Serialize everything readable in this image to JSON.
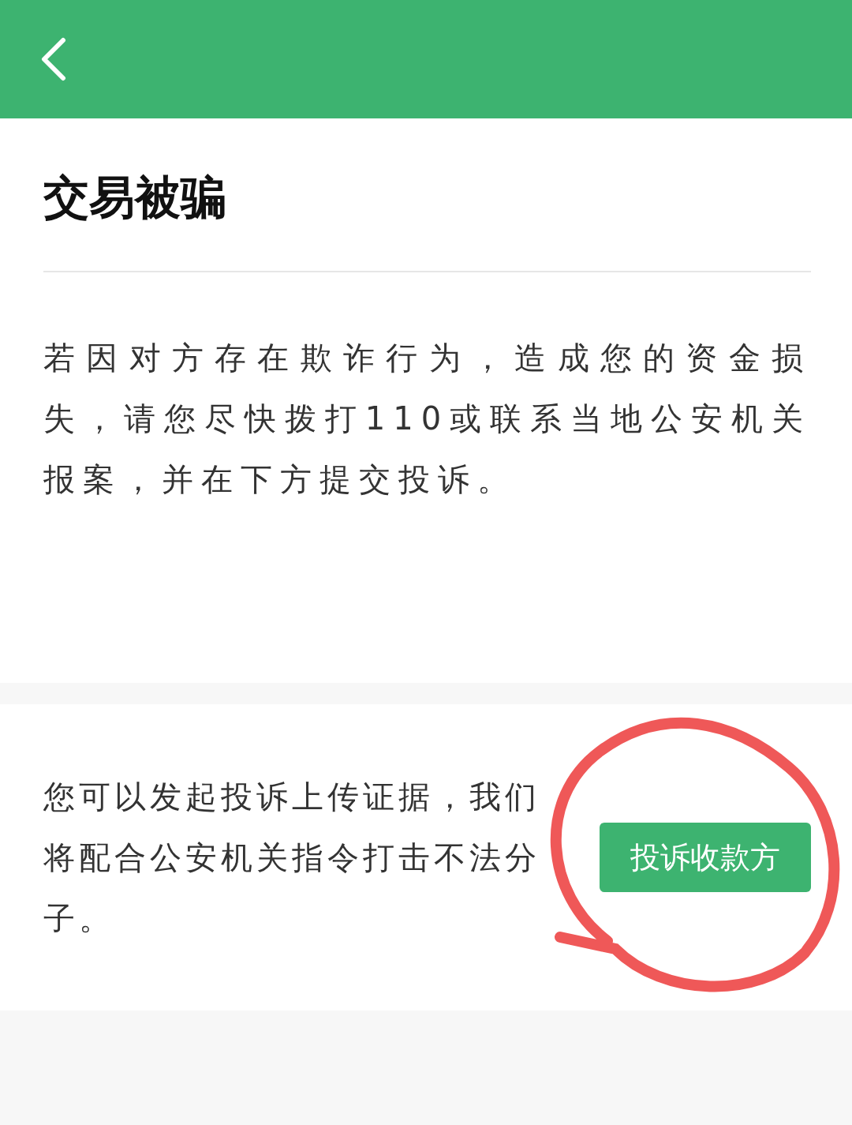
{
  "title": "交易被骗",
  "notice": "若因对方存在欺诈行为，造成您的资金损失，请您尽快拨打110或联系当地公安机关报案，并在下方提交投诉。",
  "complaint": {
    "text": "您可以发起投诉上传证据，我们将配合公安机关指令打击不法分子。",
    "button": "投诉收款方"
  }
}
